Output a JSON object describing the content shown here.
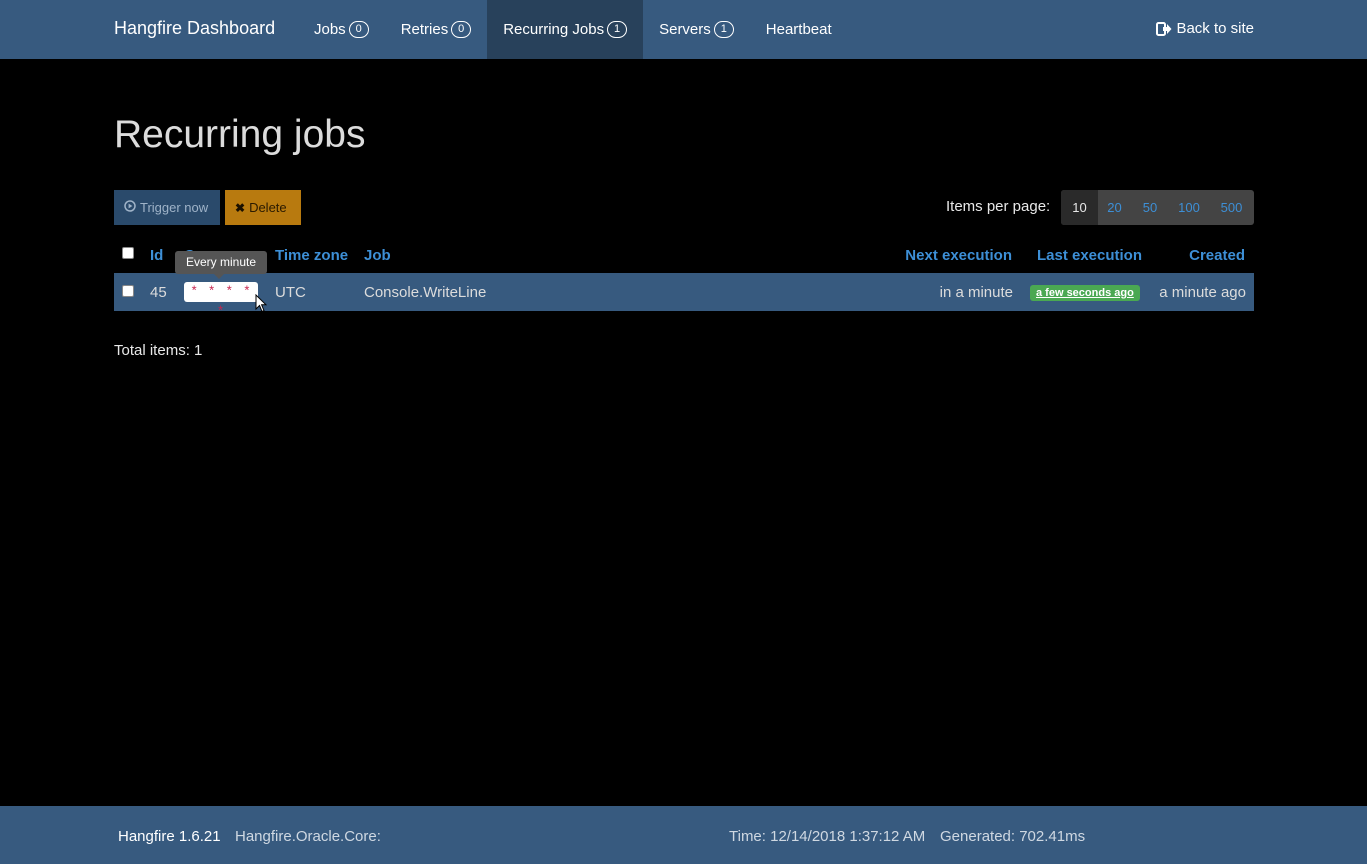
{
  "nav": {
    "brand": "Hangfire Dashboard",
    "items": [
      {
        "label": "Jobs",
        "badge": "0"
      },
      {
        "label": "Retries",
        "badge": "0"
      },
      {
        "label": "Recurring Jobs",
        "badge": "1"
      },
      {
        "label": "Servers",
        "badge": "1"
      },
      {
        "label": "Heartbeat"
      }
    ],
    "active": "Recurring Jobs",
    "back_label": "Back to site",
    "back_icon": "sign-out-icon"
  },
  "page": {
    "title": "Recurring jobs"
  },
  "toolbar": {
    "trigger_label": "Trigger now",
    "trigger_icon": "play-circle-icon",
    "delete_label": "Delete",
    "delete_icon": "close-icon",
    "per_page_label": "Items per page:",
    "per_page_options": [
      "10",
      "20",
      "50",
      "100",
      "500"
    ],
    "per_page_selected": "10"
  },
  "table": {
    "headers": {
      "id": "Id",
      "cron": "Cron",
      "timezone": "Time zone",
      "job": "Job",
      "next": "Next execution",
      "last": "Last execution",
      "created": "Created"
    },
    "rows": [
      {
        "id": "45",
        "cron": "* * * * *",
        "timezone": "UTC",
        "job": "Console.WriteLine",
        "next": "in a minute",
        "last": "a few seconds ago",
        "created": "a minute ago"
      }
    ]
  },
  "tooltip": {
    "text": "Every minute"
  },
  "total": "Total items: 1",
  "footer": {
    "version": "Hangfire 1.6.21",
    "storage": "Hangfire.Oracle.Core:",
    "time": "Time: 12/14/2018 1:37:12 AM",
    "generated": "Generated: 702.41ms"
  },
  "colors": {
    "navbar": "#375a7f",
    "link": "#3d8fd6",
    "success": "#4aa852",
    "warning": "#b87a0f"
  }
}
